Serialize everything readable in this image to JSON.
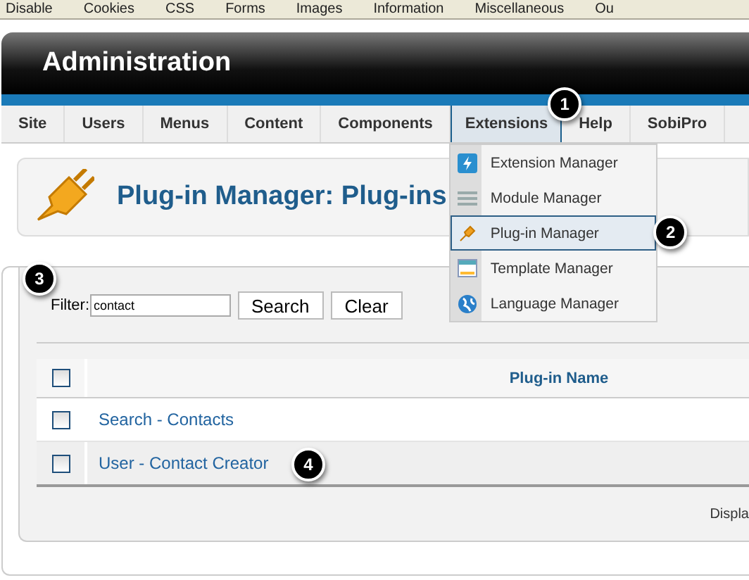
{
  "browser_toolbar": {
    "items": [
      "Disable",
      "Cookies",
      "CSS",
      "Forms",
      "Images",
      "Information",
      "Miscellaneous",
      "Ou"
    ]
  },
  "header": {
    "title": "Administration"
  },
  "menu": [
    {
      "label": "Site",
      "selected": false
    },
    {
      "label": "Users",
      "selected": false
    },
    {
      "label": "Menus",
      "selected": false
    },
    {
      "label": "Content",
      "selected": false
    },
    {
      "label": "Components",
      "selected": false
    },
    {
      "label": "Extensions",
      "selected": true
    },
    {
      "label": "Help",
      "selected": false
    },
    {
      "label": "SobiPro",
      "selected": false
    }
  ],
  "dropdown": [
    {
      "label": "Extension Manager",
      "kind": "extension",
      "selected": false
    },
    {
      "label": "Module Manager",
      "kind": "module",
      "selected": false
    },
    {
      "label": "Plug-in Manager",
      "kind": "plugin",
      "selected": true
    },
    {
      "label": "Template Manager",
      "kind": "template",
      "selected": false
    },
    {
      "label": "Language Manager",
      "kind": "language",
      "selected": false
    }
  ],
  "page_title": "Plug-in Manager: Plug-ins",
  "filter": {
    "label": "Filter:",
    "value": "contact",
    "buttons": [
      "Search",
      "Clear"
    ]
  },
  "table": {
    "header": {
      "checked": false,
      "column": "Plug-in Name"
    },
    "rows": [
      {
        "checked": false,
        "name": "Search - Contacts"
      },
      {
        "checked": false,
        "name": "User - Contact Creator"
      }
    ],
    "footer": "Displa"
  },
  "callouts": [
    "1",
    "2",
    "3",
    "4"
  ]
}
